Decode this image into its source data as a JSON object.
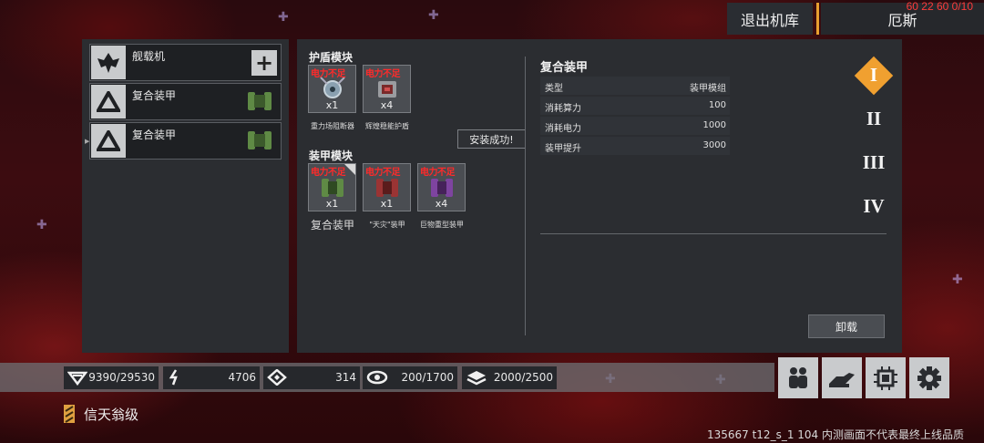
{
  "topbar": {
    "exit_label": "退出机库",
    "pilot_name": "厄斯",
    "debug_text": "60 22 60 0/10"
  },
  "slots": [
    {
      "label": "舰载机",
      "icon": "fighter-icon",
      "action": "add"
    },
    {
      "label": "复合装甲",
      "icon": "armor-slot-icon",
      "thumb": "armor-module-icon"
    },
    {
      "label": "复合装甲",
      "icon": "armor-slot-icon",
      "thumb": "armor-module-icon"
    }
  ],
  "shield_section": {
    "title": "护盾模块",
    "modules": [
      {
        "warning": "电力不足",
        "qty": "x1",
        "name": "重力场阻断器",
        "color": "#6b7a86"
      },
      {
        "warning": "电力不足",
        "qty": "x4",
        "name": "辉煌稳能护盾",
        "color": "#6b6e72"
      }
    ]
  },
  "toast": "安装成功!",
  "armor_section": {
    "title": "装甲模块",
    "modules": [
      {
        "warning": "电力不足",
        "qty": "x1",
        "name": "复合装甲",
        "color": "#4e7a3a"
      },
      {
        "warning": "电力不足",
        "qty": "x1",
        "name": "\"天灾\"装甲",
        "color": "#8a2e2e"
      },
      {
        "warning": "电力不足",
        "qty": "x4",
        "name": "巨物重型装甲",
        "color": "#6e3a8a"
      }
    ]
  },
  "detail": {
    "title": "复合装甲",
    "stats": [
      {
        "key": "类型",
        "value": "装甲模组"
      },
      {
        "key": "消耗算力",
        "value": "100"
      },
      {
        "key": "消耗电力",
        "value": "1000"
      },
      {
        "key": "装甲提升",
        "value": "3000"
      }
    ],
    "unload_label": "卸载"
  },
  "tiers": [
    "I",
    "II",
    "III",
    "IV"
  ],
  "resources": [
    {
      "icon": "gem-icon",
      "value": "9390/29530"
    },
    {
      "icon": "energy-icon",
      "value": "4706"
    },
    {
      "icon": "core-icon",
      "value": "314"
    },
    {
      "icon": "eye-icon",
      "value": "200/1700"
    },
    {
      "icon": "layers-icon",
      "value": "2000/2500"
    }
  ],
  "side_buttons": [
    "crew-icon",
    "hand-icon",
    "chip-icon",
    "gear-icon"
  ],
  "rank": {
    "label": "信天翁级"
  },
  "footer_note": "135667 t12_s_1 104  内测画面不代表最终上线品质",
  "colors": {
    "accent": "#f0a030",
    "warning": "#ff2a2a",
    "panel": "#2b2d31"
  }
}
